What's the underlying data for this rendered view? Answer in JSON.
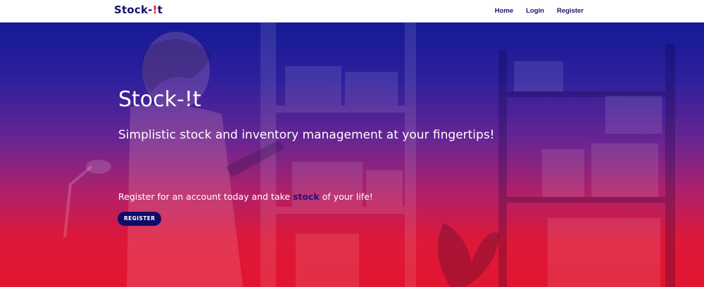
{
  "brand": {
    "name_start": "Stock-",
    "name_bang": "!",
    "name_end": "t"
  },
  "nav": {
    "items": [
      {
        "label": "Home"
      },
      {
        "label": "Login"
      },
      {
        "label": "Register"
      }
    ]
  },
  "hero": {
    "title": "Stock-!t",
    "subtitle": "Simplistic stock and inventory management at your fingertips!",
    "cta_before": "Register for an account today and take ",
    "cta_highlight": "stock",
    "cta_after": " of your life!",
    "button_label": "REGISTER",
    "background_image": "woman-with-clipboard-in-storeroom-photo"
  },
  "colors": {
    "brand_navy": "#14126e",
    "brand_red": "#e8122a",
    "gradient_top": "#141a96",
    "gradient_bottom": "#e21530",
    "button_bg": "#0f0b6a"
  }
}
